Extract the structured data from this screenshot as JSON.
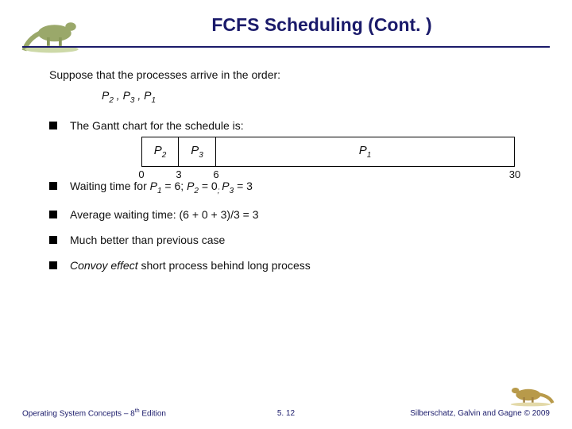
{
  "title": "FCFS Scheduling (Cont. )",
  "intro": "Suppose that the processes arrive in the order:",
  "order_parts": {
    "p2": "P",
    "s2": "2",
    "sep1": " , ",
    "p3": "P",
    "s3": "3",
    "sep2": " , ",
    "p1": "P",
    "s1": "1"
  },
  "bullets": {
    "b1_prefix": "The Gantt chart for the schedule is:",
    "b2_prefix": "Waiting time for ",
    "b2_p1": "P",
    "b2_s1": "1",
    "b2_eq1": " = 6; ",
    "b2_p2": "P",
    "b2_s2": "2",
    "b2_eq2": " = 0",
    "b2_sep": "; ",
    "b2_p3": "P",
    "b2_s3": "3",
    "b2_eq3": " = 3",
    "b3": "Average waiting time:   (6 + 0 + 3)/3 = 3",
    "b4": "Much better than previous case",
    "b5_emph": "Convoy effect",
    "b5_rest": " short process behind long process"
  },
  "footer": {
    "left_a": "Operating System Concepts – 8",
    "left_sup": "th",
    "left_b": " Edition",
    "center": "5. 12",
    "right": "Silberschatz, Galvin and Gagne © 2009"
  },
  "chart_data": {
    "type": "bar",
    "title": "Gantt chart",
    "series": [
      {
        "name": "P2",
        "start": 0,
        "end": 3
      },
      {
        "name": "P3",
        "start": 3,
        "end": 6
      },
      {
        "name": "P1",
        "start": 6,
        "end": 30
      }
    ],
    "ticks": [
      0,
      3,
      6,
      30
    ],
    "xlim": [
      0,
      30
    ],
    "xlabel": "",
    "ylabel": ""
  }
}
